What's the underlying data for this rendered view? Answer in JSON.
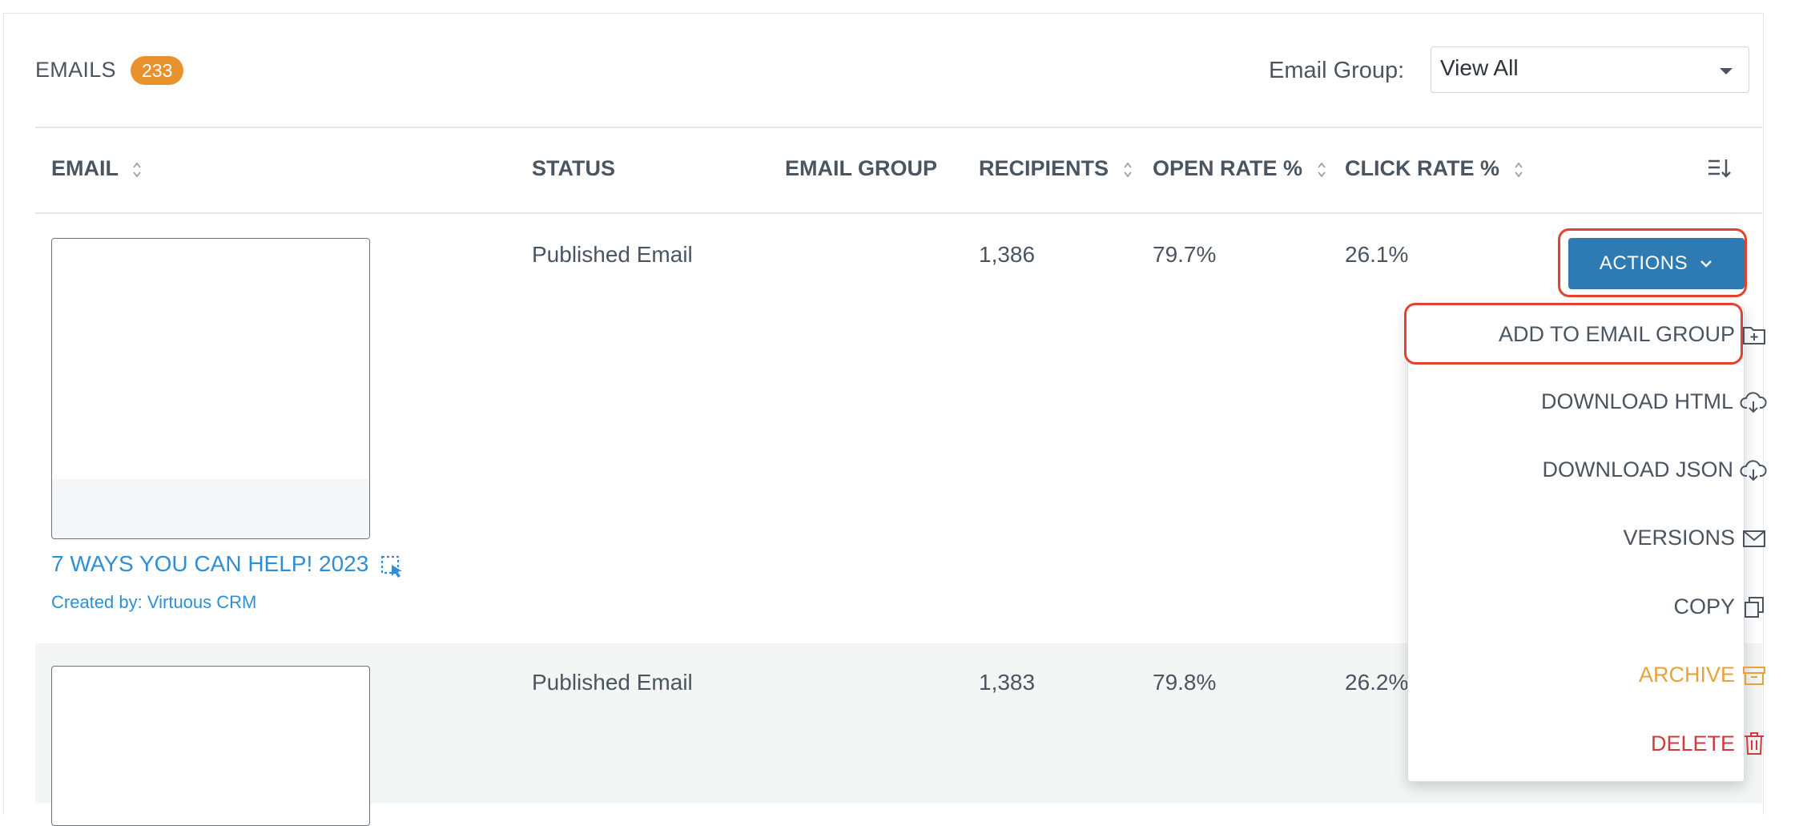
{
  "header": {
    "title": "EMAILS",
    "count": "233",
    "group_label": "Email Group:",
    "group_value": "View All"
  },
  "columns": {
    "email": "EMAIL",
    "status": "STATUS",
    "email_group": "EMAIL GROUP",
    "recipients": "RECIPIENTS",
    "open_rate": "OPEN RATE %",
    "click_rate": "CLICK RATE %"
  },
  "rows": [
    {
      "status": "Published Email",
      "recipients": "1,386",
      "open_rate": "79.7%",
      "click_rate": "26.1%",
      "name": "7 WAYS YOU CAN HELP! 2023",
      "created_by": "Created by: Virtuous CRM"
    },
    {
      "status": "Published Email",
      "recipients": "1,383",
      "open_rate": "79.8%",
      "click_rate": "26.2%"
    }
  ],
  "actions_label": "ACTIONS",
  "menu": {
    "add_group": "ADD TO EMAIL GROUP",
    "download_html": "DOWNLOAD HTML",
    "download_json": "DOWNLOAD JSON",
    "versions": "VERSIONS",
    "copy": "COPY",
    "archive": "ARCHIVE",
    "delete": "DELETE"
  },
  "colors": {
    "accent": "#2e7bb3",
    "badge": "#e7922d",
    "link": "#2f8fd6",
    "archive": "#e9a23b",
    "delete": "#d23b3b",
    "highlight": "#e0432f"
  }
}
